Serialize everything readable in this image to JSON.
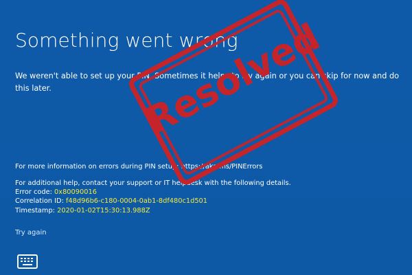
{
  "screen": {
    "title": "Something went wrong",
    "message": "We weren't able to set up your PIN. Sometimes it helps to try again or you can skip for now and do this later.",
    "help_link_line": "For more information on errors during PIN setup: https://aka.ms/PINErrors",
    "support_line": "For additional help, contact your support or IT helpdesk with the following details.",
    "error_code_label": "Error code: ",
    "error_code_value": "0x80090016",
    "correlation_label": "Correlation ID: ",
    "correlation_value": "f48d96b6-c180-0004-0ab1-8df480c1d501",
    "timestamp_label": "Timestamp: ",
    "timestamp_value": "2020-01-02T15:30:13.988Z",
    "try_again": "Try again"
  },
  "stamp": {
    "text": "Resolved",
    "color": "#c5242a"
  },
  "icons": {
    "keyboard": "keyboard-icon"
  },
  "colors": {
    "background": "#0f5ba8",
    "highlight_value": "#f4ea3f",
    "text": "#ffffff"
  }
}
